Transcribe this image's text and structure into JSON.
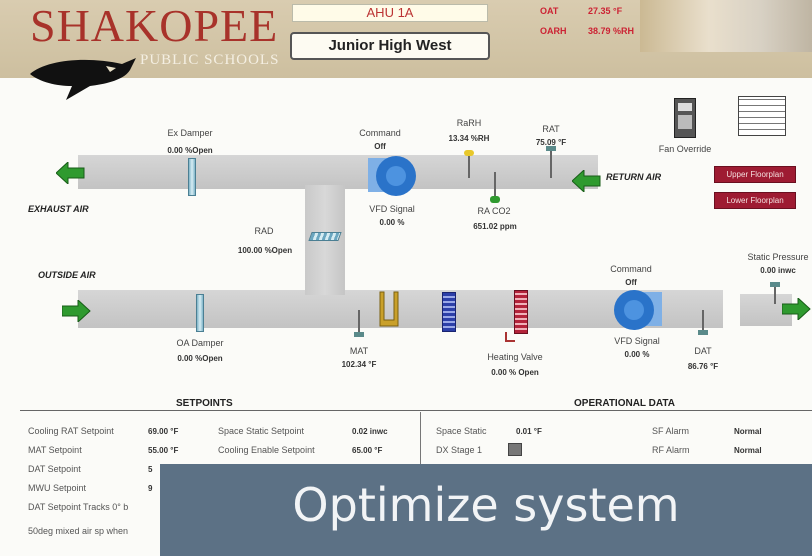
{
  "header": {
    "brand": "SHAKOPEE",
    "brand_sub": "PUBLIC SCHOOLS",
    "unit": "AHU 1A",
    "site": "Junior High West",
    "oat_label": "OAT",
    "oat_value": "27.35 °F",
    "oarh_label": "OARH",
    "oarh_value": "38.79 %RH"
  },
  "diagram": {
    "ex_damper_label": "Ex Damper",
    "ex_damper_value": "0.00 %Open",
    "command_top_label": "Command",
    "command_top_value": "Off",
    "rarh_label": "RaRH",
    "rarh_value": "13.34 %RH",
    "rat_label": "RAT",
    "rat_value": "75.09 °F",
    "fan_override_label": "Fan Override",
    "return_air_label": "RETURN AIR",
    "exhaust_air_label": "EXHAUST AIR",
    "vfd_top_label": "VFD Signal",
    "vfd_top_value": "0.00 %",
    "ra_co2_label": "RA CO2",
    "ra_co2_value": "651.02 ppm",
    "rad_label": "RAD",
    "rad_value": "100.00 %Open",
    "outside_air_label": "OUTSIDE AIR",
    "command_bottom_label": "Command",
    "command_bottom_value": "Off",
    "static_pressure_label": "Static Pressure",
    "static_pressure_value": "0.00 inwc",
    "oa_damper_label": "OA Damper",
    "oa_damper_value": "0.00 %Open",
    "mat_label": "MAT",
    "mat_value": "102.34 °F",
    "heating_valve_label": "Heating Valve",
    "heating_valve_value": "0.00 % Open",
    "vfd_bottom_label": "VFD Signal",
    "vfd_bottom_value": "0.00 %",
    "dat_label": "DAT",
    "dat_value": "86.76 °F",
    "upper_floorplan": "Upper Floorplan",
    "lower_floorplan": "Lower Floorplan"
  },
  "setpoints": {
    "title": "SETPOINTS",
    "rows_left": [
      {
        "label": "Cooling RAT Setpoint",
        "value": "69.00 °F"
      },
      {
        "label": "MAT Setpoint",
        "value": "55.00 °F"
      },
      {
        "label": "DAT Setpoint",
        "value": "5"
      },
      {
        "label": "MWU Setpoint",
        "value": "9"
      },
      {
        "label": "DAT Setpoint Tracks 0° b",
        "value": ""
      },
      {
        "label": "50deg mixed air sp when",
        "value": ""
      }
    ],
    "rows_right": [
      {
        "label": "Space Static Setpoint",
        "value": "0.02 inwc"
      },
      {
        "label": "Cooling Enable Setpoint",
        "value": "65.00 °F"
      }
    ]
  },
  "operational": {
    "title": "OPERATIONAL DATA",
    "space_static_label": "Space Static",
    "space_static_value": "0.01 °F",
    "dx_stage_label": "DX Stage 1",
    "sf_alarm_label": "SF Alarm",
    "sf_alarm_value": "Normal",
    "rf_alarm_label": "RF Alarm",
    "rf_alarm_value": "Normal"
  },
  "overlay": {
    "text": "Optimize system"
  },
  "colors": {
    "brand_red": "#a8322a",
    "arrow_green": "#2f9a2f",
    "fan_blue": "#2a73c9",
    "floorplan_red": "#9e1b32"
  }
}
